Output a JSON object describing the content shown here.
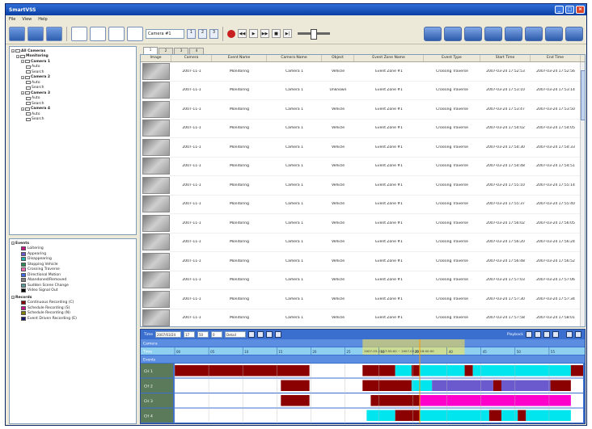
{
  "window": {
    "title": "SmartVSS"
  },
  "menu": [
    "File",
    "View",
    "Help"
  ],
  "toolbar": {
    "camera_select": "Camera #1",
    "page_buttons": [
      "1",
      "2",
      "3"
    ]
  },
  "camera_tree": {
    "items": [
      {
        "label": "All Cameras",
        "level": 0,
        "bold": true
      },
      {
        "label": "Monitoring",
        "level": 1,
        "bold": true
      },
      {
        "label": "Camera 1",
        "level": 2,
        "bold": true
      },
      {
        "label": "Auto",
        "level": 3
      },
      {
        "label": "Search",
        "level": 3
      },
      {
        "label": "Camera 2",
        "level": 2,
        "bold": true
      },
      {
        "label": "Auto",
        "level": 3
      },
      {
        "label": "Search",
        "level": 3
      },
      {
        "label": "Camera 3",
        "level": 2,
        "bold": true
      },
      {
        "label": "Auto",
        "level": 3
      },
      {
        "label": "Search",
        "level": 3
      },
      {
        "label": "Camera 4",
        "level": 2,
        "bold": true
      },
      {
        "label": "Auto",
        "level": 3
      },
      {
        "label": "Search",
        "level": 3
      }
    ]
  },
  "legend": {
    "events_title": "Events",
    "events": [
      {
        "label": "Loitering",
        "color": "#c71585"
      },
      {
        "label": "Appearing",
        "color": "#6a5acd"
      },
      {
        "label": "Disappearing",
        "color": "#20b2aa"
      },
      {
        "label": "Stopping Vehicle",
        "color": "#2e8b57"
      },
      {
        "label": "Crossing Traverse",
        "color": "#ff69b4"
      },
      {
        "label": "Directional Motion",
        "color": "#4169e1"
      },
      {
        "label": "Abandoned/Removed",
        "color": "#808080"
      },
      {
        "label": "Sudden Scene Change",
        "color": "#5a9a9a"
      },
      {
        "label": "Video Signal Out",
        "color": "#000000"
      }
    ],
    "records_title": "Records",
    "records": [
      {
        "label": "Continuous Recording (C)",
        "color": "#8b0000"
      },
      {
        "label": "Schedule Recording (S)",
        "color": "#c71585"
      },
      {
        "label": "Schedule Recording (N)",
        "color": "#808000"
      },
      {
        "label": "Event Driven Recording (E)",
        "color": "#191970"
      }
    ]
  },
  "tabs": [
    "1",
    "2",
    "3",
    "4"
  ],
  "grid": {
    "columns": [
      "Image",
      "Camera",
      "Event Name",
      "Camera Name",
      "Object",
      "Event Zone Name",
      "Event Type",
      "Start Time",
      "End Time"
    ],
    "rows": [
      [
        "2007-11-1",
        "Monitoring",
        "Camera 1",
        "Vehicle",
        "Event Zone #1",
        "Crossing Traverse",
        "2007-03-24 17:52:53",
        "2007-03-24 17:52:56"
      ],
      [
        "2007-11-1",
        "Monitoring",
        "Camera 1",
        "Unknown",
        "Event Zone #1",
        "Crossing Traverse",
        "2007-03-24 17:53:10",
        "2007-03-24 17:53:14"
      ],
      [
        "2007-11-1",
        "Monitoring",
        "Camera 1",
        "Vehicle",
        "Event Zone #1",
        "Crossing Traverse",
        "2007-03-24 17:53:47",
        "2007-03-24 17:53:50"
      ],
      [
        "2007-11-1",
        "Monitoring",
        "Camera 1",
        "Vehicle",
        "Event Zone #1",
        "Crossing Traverse",
        "2007-03-24 17:54:02",
        "2007-03-24 17:54:05"
      ],
      [
        "2007-11-1",
        "Monitoring",
        "Camera 1",
        "Vehicle",
        "Event Zone #1",
        "Crossing Traverse",
        "2007-03-24 17:54:30",
        "2007-03-24 17:54:33"
      ],
      [
        "2007-11-1",
        "Monitoring",
        "Camera 1",
        "Vehicle",
        "Event Zone #1",
        "Crossing Traverse",
        "2007-03-24 17:54:48",
        "2007-03-24 17:54:51"
      ],
      [
        "2007-11-1",
        "Monitoring",
        "Camera 1",
        "Vehicle",
        "Event Zone #1",
        "Crossing Traverse",
        "2007-03-24 17:55:10",
        "2007-03-24 17:55:14"
      ],
      [
        "2007-11-1",
        "Monitoring",
        "Camera 1",
        "Vehicle",
        "Event Zone #1",
        "Crossing Traverse",
        "2007-03-24 17:55:37",
        "2007-03-24 17:55:40"
      ],
      [
        "2007-11-1",
        "Monitoring",
        "Camera 1",
        "Vehicle",
        "Event Zone #1",
        "Crossing Traverse",
        "2007-03-24 17:56:02",
        "2007-03-24 17:56:05"
      ],
      [
        "2007-11-1",
        "Monitoring",
        "Camera 1",
        "Vehicle",
        "Event Zone #1",
        "Crossing Traverse",
        "2007-03-24 17:56:20",
        "2007-03-24 17:56:24"
      ],
      [
        "2007-11-1",
        "Monitoring",
        "Camera 1",
        "Vehicle",
        "Event Zone #1",
        "Crossing Traverse",
        "2007-03-24 17:56:48",
        "2007-03-24 17:56:52"
      ],
      [
        "2007-11-1",
        "Monitoring",
        "Camera 1",
        "Vehicle",
        "Event Zone #1",
        "Crossing Traverse",
        "2007-03-24 17:57:03",
        "2007-03-24 17:57:06"
      ],
      [
        "2007-11-1",
        "Monitoring",
        "Camera 1",
        "Vehicle",
        "Event Zone #1",
        "Crossing Traverse",
        "2007-03-24 17:57:30",
        "2007-03-24 17:57:34"
      ],
      [
        "2007-11-1",
        "Monitoring",
        "Camera 1",
        "Vehicle",
        "Event Zone #1",
        "Crossing Traverse",
        "2007-03-24 17:57:58",
        "2007-03-24 17:58:01"
      ]
    ]
  },
  "timeline": {
    "toolbar": {
      "interval_label": "Time",
      "date_value": "2007/03/24",
      "hour_value": "17",
      "minute_value": "50",
      "second_value": "0",
      "scale_value": "Detail",
      "playback_label": "Playback"
    },
    "header_rows": [
      "Camera",
      "Time",
      "Events"
    ],
    "ticks": [
      "00",
      "05",
      "10",
      "15",
      "20",
      "25",
      "30",
      "35",
      "40",
      "45",
      "50",
      "55"
    ],
    "selection_label": "2007-03-24 17:55:00 ~ 2007-03-24 18:00:00",
    "tracks": [
      {
        "label": "CH 1",
        "segments": [
          {
            "from": 0,
            "to": 0.33,
            "color": "#8b0000"
          },
          {
            "from": 0.46,
            "to": 0.54,
            "color": "#8b0000"
          },
          {
            "from": 0.54,
            "to": 0.58,
            "color": "#00e5ee"
          },
          {
            "from": 0.58,
            "to": 0.6,
            "color": "#8b0000"
          },
          {
            "from": 0.6,
            "to": 0.71,
            "color": "#00e5ee"
          },
          {
            "from": 0.71,
            "to": 0.73,
            "color": "#8b0000"
          },
          {
            "from": 0.73,
            "to": 0.97,
            "color": "#00e5ee"
          },
          {
            "from": 0.97,
            "to": 1,
            "color": "#8b0000"
          }
        ]
      },
      {
        "label": "CH 2",
        "segments": [
          {
            "from": 0.26,
            "to": 0.33,
            "color": "#8b0000"
          },
          {
            "from": 0.46,
            "to": 0.58,
            "color": "#8b0000"
          },
          {
            "from": 0.58,
            "to": 0.63,
            "color": "#00e5ee"
          },
          {
            "from": 0.63,
            "to": 0.78,
            "color": "#6a5acd"
          },
          {
            "from": 0.78,
            "to": 0.8,
            "color": "#8b0000"
          },
          {
            "from": 0.8,
            "to": 0.92,
            "color": "#6a5acd"
          },
          {
            "from": 0.92,
            "to": 0.97,
            "color": "#8b0000"
          }
        ]
      },
      {
        "label": "CH 3",
        "segments": [
          {
            "from": 0.26,
            "to": 0.33,
            "color": "#8b0000"
          },
          {
            "from": 0.48,
            "to": 0.6,
            "color": "#8b0000"
          },
          {
            "from": 0.6,
            "to": 0.97,
            "color": "#ff00cc"
          }
        ]
      },
      {
        "label": "CH 4",
        "segments": [
          {
            "from": 0.47,
            "to": 0.54,
            "color": "#00e5ee"
          },
          {
            "from": 0.54,
            "to": 0.6,
            "color": "#8b0000"
          },
          {
            "from": 0.6,
            "to": 0.77,
            "color": "#00e5ee"
          },
          {
            "from": 0.77,
            "to": 0.8,
            "color": "#8b0000"
          },
          {
            "from": 0.8,
            "to": 0.84,
            "color": "#00e5ee"
          },
          {
            "from": 0.84,
            "to": 0.86,
            "color": "#8b0000"
          },
          {
            "from": 0.86,
            "to": 0.97,
            "color": "#00e5ee"
          }
        ]
      }
    ],
    "cursor_fraction": 0.6,
    "selection": {
      "from": 0.46,
      "to": 0.71
    }
  }
}
